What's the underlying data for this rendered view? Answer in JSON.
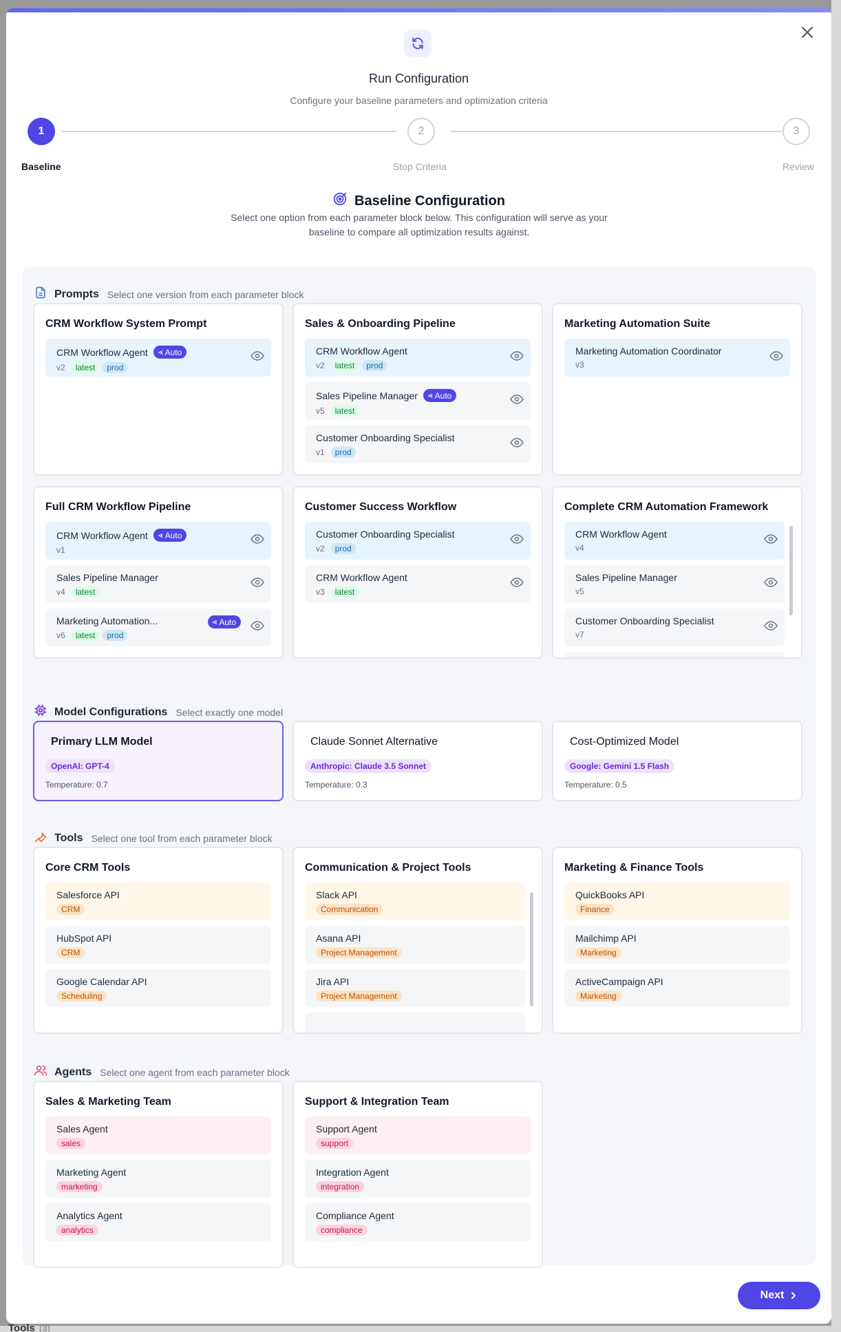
{
  "modal": {
    "title": "Run Configuration",
    "subtitle": "Configure your baseline parameters and optimization criteria",
    "header_icon": "refresh-icon",
    "close_icon": "close-icon"
  },
  "stepper": [
    {
      "number": "1",
      "label": "Baseline",
      "active": true
    },
    {
      "number": "2",
      "label": "Stop Criteria",
      "active": false
    },
    {
      "number": "3",
      "label": "Review",
      "active": false
    }
  ],
  "section": {
    "title": "Baseline Configuration",
    "icon": "target-icon",
    "description": "Select one option from each parameter block below. This configuration will serve as your baseline to compare all optimization results against."
  },
  "prompts": {
    "name": "Prompts",
    "hint": "Select one version from each parameter block",
    "icon": "document-icon",
    "auto_label": "Auto",
    "blocks": [
      {
        "title": "CRM Workflow System Prompt",
        "items": [
          {
            "name": "CRM Workflow Agent",
            "version": "v2",
            "tags": [
              "latest",
              "prod"
            ],
            "auto": true,
            "selected": true
          }
        ]
      },
      {
        "title": "Sales & Onboarding Pipeline",
        "items": [
          {
            "name": "CRM Workflow Agent",
            "version": "v2",
            "tags": [
              "latest",
              "prod"
            ],
            "auto": false,
            "selected": true
          },
          {
            "name": "Sales Pipeline Manager",
            "version": "v5",
            "tags": [
              "latest"
            ],
            "auto": true,
            "selected": false
          },
          {
            "name": "Customer Onboarding Specialist",
            "version": "v1",
            "tags": [
              "prod"
            ],
            "auto": false,
            "selected": false
          }
        ]
      },
      {
        "title": "Marketing Automation Suite",
        "items": [
          {
            "name": "Marketing Automation Coordinator",
            "version": "v3",
            "tags": [],
            "auto": false,
            "selected": true
          }
        ]
      },
      {
        "title": "Full CRM Workflow Pipeline",
        "items": [
          {
            "name": "CRM Workflow Agent",
            "version": "v1",
            "tags": [],
            "auto": true,
            "selected": true
          },
          {
            "name": "Sales Pipeline Manager",
            "version": "v4",
            "tags": [
              "latest"
            ],
            "auto": false,
            "selected": false
          },
          {
            "name": "Marketing Automation...",
            "version": "v6",
            "tags": [
              "latest",
              "prod"
            ],
            "auto": true,
            "selected": false
          }
        ]
      },
      {
        "title": "Customer Success Workflow",
        "items": [
          {
            "name": "Customer Onboarding Specialist",
            "version": "v2",
            "tags": [
              "prod"
            ],
            "auto": false,
            "selected": true
          },
          {
            "name": "CRM Workflow Agent",
            "version": "v3",
            "tags": [
              "latest"
            ],
            "auto": false,
            "selected": false
          }
        ]
      },
      {
        "title": "Complete CRM Automation Framework",
        "items": [
          {
            "name": "CRM Workflow Agent",
            "version": "v4",
            "tags": [],
            "auto": false,
            "selected": true
          },
          {
            "name": "Sales Pipeline Manager",
            "version": "v5",
            "tags": [],
            "auto": false,
            "selected": false
          },
          {
            "name": "Customer Onboarding Specialist",
            "version": "v7",
            "tags": [],
            "auto": false,
            "selected": false
          }
        ]
      }
    ]
  },
  "models": {
    "name": "Model Configurations",
    "hint": "Select exactly one model",
    "icon": "chip-icon",
    "items": [
      {
        "title": "Primary LLM Model",
        "provider": "OpenAI: GPT-4",
        "temperature": "Temperature: 0.7",
        "selected": true
      },
      {
        "title": "Claude Sonnet Alternative",
        "provider": "Anthropic: Claude 3.5 Sonnet",
        "temperature": "Temperature: 0.3",
        "selected": false
      },
      {
        "title": "Cost-Optimized Model",
        "provider": "Google: Gemini 1.5 Flash",
        "temperature": "Temperature: 0.5",
        "selected": false
      }
    ]
  },
  "tools": {
    "name": "Tools",
    "hint": "Select one tool from each parameter block",
    "icon": "wrench-icon",
    "blocks": [
      {
        "title": "Core CRM Tools",
        "items": [
          {
            "name": "Salesforce API",
            "category": "CRM",
            "selected": true
          },
          {
            "name": "HubSpot API",
            "category": "CRM",
            "selected": false
          },
          {
            "name": "Google Calendar API",
            "category": "Scheduling",
            "selected": false
          }
        ]
      },
      {
        "title": "Communication & Project Tools",
        "items": [
          {
            "name": "Slack API",
            "category": "Communication",
            "selected": true
          },
          {
            "name": "Asana API",
            "category": "Project Management",
            "selected": false
          },
          {
            "name": "Jira API",
            "category": "Project Management",
            "selected": false
          }
        ]
      },
      {
        "title": "Marketing & Finance Tools",
        "items": [
          {
            "name": "QuickBooks API",
            "category": "Finance",
            "selected": true
          },
          {
            "name": "Mailchimp API",
            "category": "Marketing",
            "selected": false
          },
          {
            "name": "ActiveCampaign API",
            "category": "Marketing",
            "selected": false
          }
        ]
      }
    ]
  },
  "agents": {
    "name": "Agents",
    "hint": "Select one agent from each parameter block",
    "icon": "users-icon",
    "blocks": [
      {
        "title": "Sales & Marketing Team",
        "items": [
          {
            "name": "Sales Agent",
            "role": "sales",
            "selected": true
          },
          {
            "name": "Marketing Agent",
            "role": "marketing",
            "selected": false
          },
          {
            "name": "Analytics Agent",
            "role": "analytics",
            "selected": false
          }
        ]
      },
      {
        "title": "Support & Integration Team",
        "items": [
          {
            "name": "Support Agent",
            "role": "support",
            "selected": true
          },
          {
            "name": "Integration Agent",
            "role": "integration",
            "selected": false
          },
          {
            "name": "Compliance Agent",
            "role": "compliance",
            "selected": false
          }
        ]
      }
    ]
  },
  "footer": {
    "next_label": "Next",
    "next_icon": "chevron-right-icon"
  },
  "background": {
    "bottom_label": "Tools",
    "bottom_count": "(3)"
  },
  "colors": {
    "accent": "#4f46e5",
    "selected_blue": "#e8f4fd",
    "selected_orange": "#fff8ea",
    "selected_pink": "#fdeff2",
    "model_selected": "#f7f2fd"
  }
}
